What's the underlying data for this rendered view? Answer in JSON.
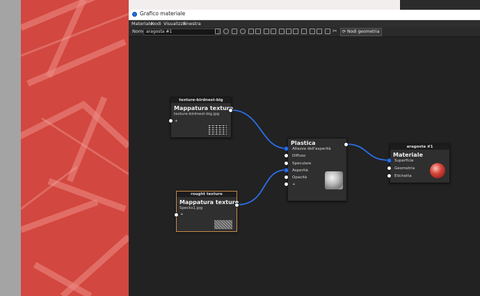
{
  "window": {
    "title": "Grafico materiale"
  },
  "menu": [
    "Materiale",
    "Nodi",
    "Visualizza",
    "Finestra"
  ],
  "toolbar": {
    "name_label": "Nome:",
    "name_value": "aragosta #1",
    "geometry_button": "Nodi geometria"
  },
  "nodes": {
    "tex1": {
      "header": "texture-birdnest-big",
      "title": "Mappatura texture",
      "file": "texture-birdnest-big.jpg",
      "plus": "+"
    },
    "tex2": {
      "header": "rought texture",
      "title": "Mappatura texture",
      "file": "Specks1.jpg",
      "plus": "+"
    },
    "plastic": {
      "title": "Plastica",
      "inputs": [
        "Altezza dell'asperità",
        "Diffuso",
        "Speculare",
        "Asperità",
        "Opacità",
        "+"
      ]
    },
    "material": {
      "header": "aragosta #1",
      "title": "Materiale",
      "inputs": [
        "Superficie",
        "Geometria",
        "Etichetta"
      ]
    }
  },
  "colors": {
    "wire": "#2b6fe8",
    "selected_border": "#c98c4a",
    "background_red": "#d2473f"
  }
}
